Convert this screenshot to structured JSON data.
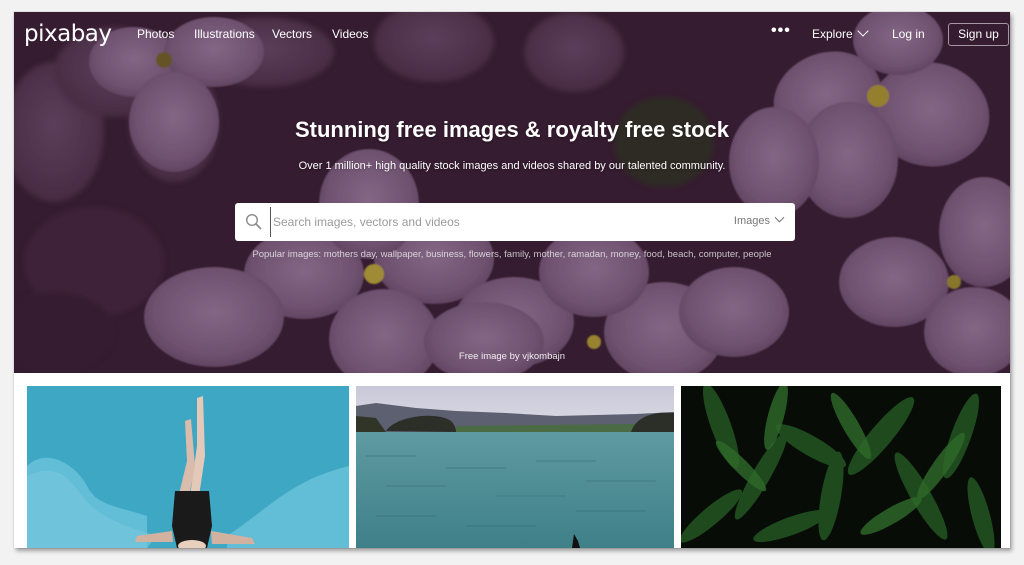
{
  "nav": {
    "logo": "pixabay",
    "links": [
      "Photos",
      "Illustrations",
      "Vectors",
      "Videos"
    ],
    "more": "•••",
    "explore": "Explore",
    "login": "Log in",
    "signup": "Sign up"
  },
  "hero": {
    "title": "Stunning free images & royalty free stock",
    "subtitle": "Over 1 million+ high quality stock images and videos shared by our talented community.",
    "credit": "Free image by vjkombajn"
  },
  "search": {
    "placeholder": "Search images, vectors and videos",
    "value": "",
    "type_selected": "Images",
    "icon": "search-icon"
  },
  "popular": {
    "label": "Popular images:",
    "tags": [
      "mothers day",
      "wallpaper",
      "business",
      "flowers",
      "family",
      "mother",
      "ramadan",
      "money",
      "food",
      "beach",
      "computer",
      "people"
    ]
  },
  "gallery": [
    {
      "subject": "woman in swimsuit on blue pool float",
      "color": "#3fa9c6"
    },
    {
      "subject": "sea bay with hills and dolphin fin",
      "color": "#4a8a94"
    },
    {
      "subject": "dark green tropical leaves",
      "color": "#0d1a0d"
    }
  ],
  "colors": {
    "hero_overlay": "#3d2337",
    "petal": "#8a6b8c",
    "flower_center": "#c7b53a",
    "text_on_hero": "#ffffff"
  }
}
